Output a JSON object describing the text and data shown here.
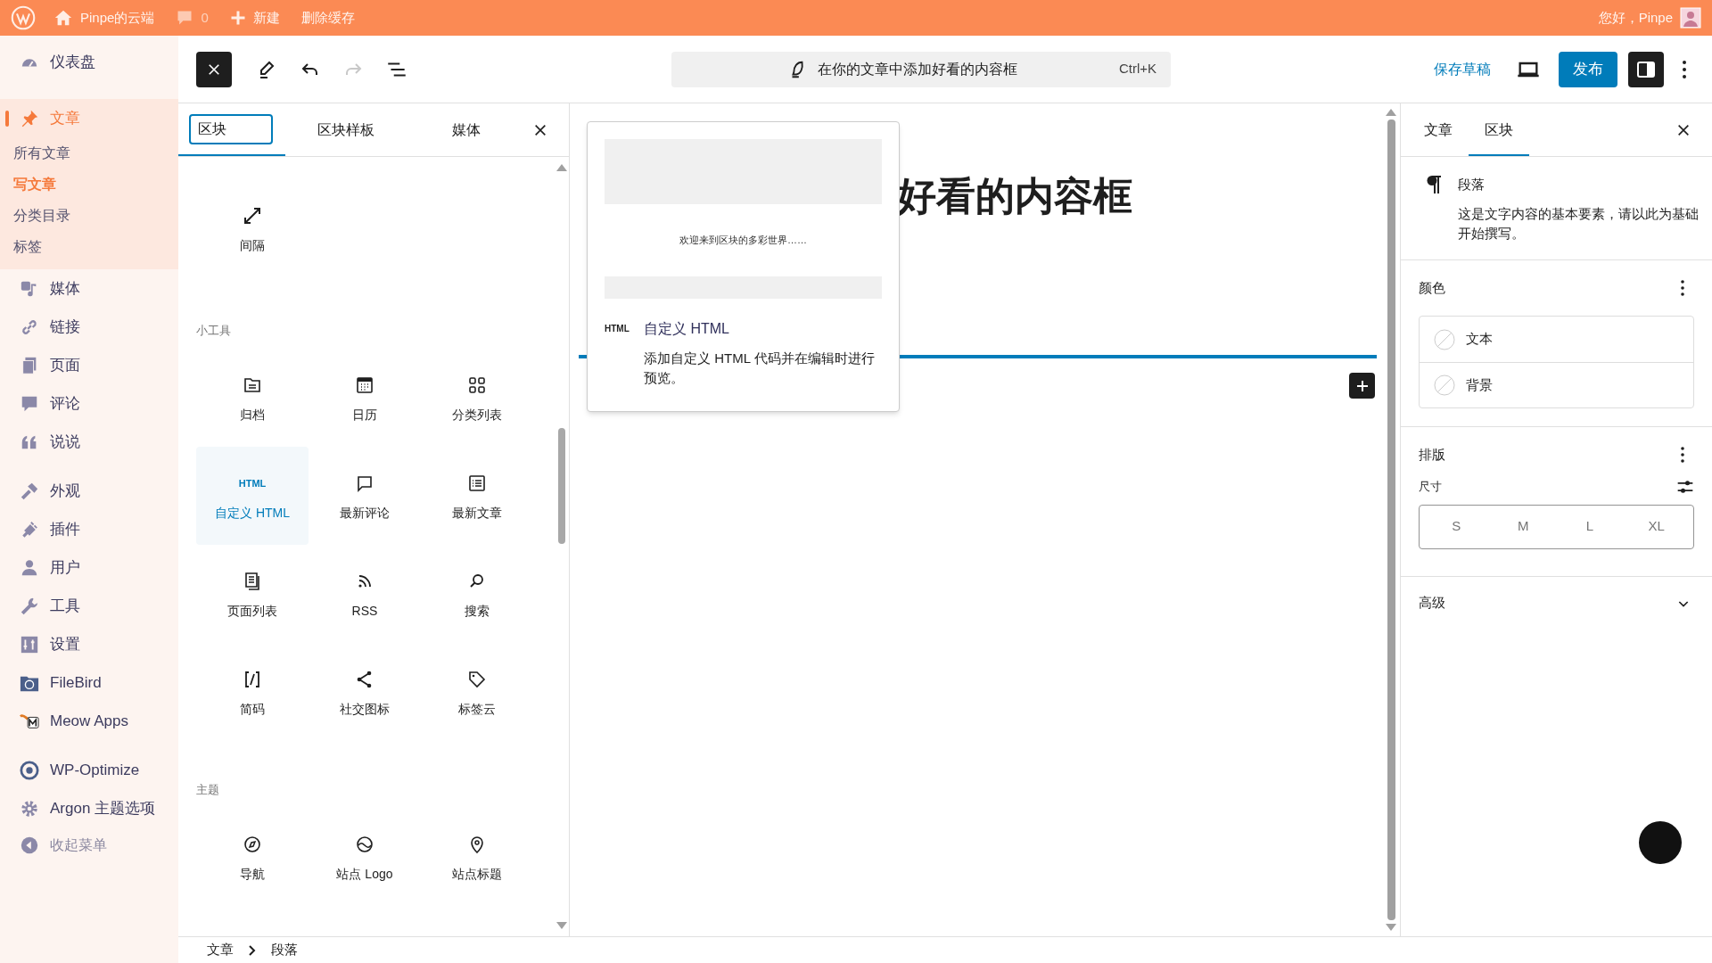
{
  "admin_bar": {
    "site": "Pinpe的云端",
    "comments": "0",
    "new": "新建",
    "clear_cache": "删除缓存",
    "greeting": "您好，Pinpe"
  },
  "sidebar": {
    "groups": [
      [
        {
          "label": "仪表盘",
          "selected": false
        }
      ],
      [
        {
          "label": "文章",
          "selected": true,
          "children": [
            {
              "label": "所有文章",
              "selected": false
            },
            {
              "label": "写文章",
              "selected": true
            },
            {
              "label": "分类目录",
              "selected": false
            },
            {
              "label": "标签",
              "selected": false
            }
          ]
        },
        {
          "label": "媒体",
          "selected": false
        },
        {
          "label": "链接",
          "selected": false
        },
        {
          "label": "页面",
          "selected": false
        },
        {
          "label": "评论",
          "selected": false
        },
        {
          "label": "说说",
          "selected": false
        }
      ],
      [
        {
          "label": "外观",
          "selected": false
        },
        {
          "label": "插件",
          "selected": false
        },
        {
          "label": "用户",
          "selected": false
        },
        {
          "label": "工具",
          "selected": false
        },
        {
          "label": "设置",
          "selected": false
        },
        {
          "label": "FileBird",
          "selected": false
        },
        {
          "label": "Meow Apps",
          "selected": false
        }
      ],
      [
        {
          "label": "WP-Optimize",
          "selected": false
        },
        {
          "label": "Argon 主题选项",
          "selected": false
        }
      ]
    ],
    "collapse": "收起菜单"
  },
  "header": {
    "redo_disabled": true,
    "command": "在你的文章中添加好看的内容框",
    "shortcut": "Ctrl+K",
    "save_draft": "保存草稿",
    "publish": "发布",
    "settings_open": true
  },
  "inserter": {
    "tabs": [
      {
        "label": "区块",
        "selected": true
      },
      {
        "label": "区块样板",
        "selected": false
      },
      {
        "label": "媒体",
        "selected": false
      }
    ],
    "sections": [
      {
        "blocks": [
          {
            "label": "间隔",
            "selected": false
          }
        ]
      },
      {
        "heading": "小工具",
        "blocks": [
          {
            "label": "归档",
            "selected": false
          },
          {
            "label": "日历",
            "selected": false
          },
          {
            "label": "分类列表",
            "selected": false
          },
          {
            "label": "自定义 HTML",
            "icon_text": "HTML",
            "selected": true
          },
          {
            "label": "最新评论",
            "selected": false
          },
          {
            "label": "最新文章",
            "selected": false
          },
          {
            "label": "页面列表",
            "selected": false
          },
          {
            "label": "RSS",
            "selected": false
          },
          {
            "label": "搜索",
            "selected": false
          },
          {
            "label": "简码",
            "selected": false
          },
          {
            "label": "社交图标",
            "selected": false
          },
          {
            "label": "标签云",
            "selected": false
          }
        ]
      },
      {
        "heading": "主题",
        "blocks": [
          {
            "label": "导航",
            "selected": false
          },
          {
            "label": "站点 Logo",
            "selected": false
          },
          {
            "label": "站点标题",
            "selected": false
          }
        ]
      }
    ]
  },
  "canvas": {
    "title_visible": "好看的内容框"
  },
  "preview": {
    "sample": "欢迎来到区块的多彩世界……",
    "icon_text": "HTML",
    "title": "自定义 HTML",
    "description": "添加自定义 HTML 代码并在编辑时进行预览。"
  },
  "settings": {
    "tabs": [
      {
        "label": "文章",
        "selected": false
      },
      {
        "label": "区块",
        "selected": true
      }
    ],
    "block": {
      "title": "段落",
      "description": "这是文字内容的基本要素，请以此为基础开始撰写。"
    },
    "color": {
      "title": "颜色",
      "items": [
        "文本",
        "背景"
      ]
    },
    "typography": {
      "title": "排版",
      "size_label": "尺寸",
      "sizes": [
        {
          "label": "S",
          "selected": false
        },
        {
          "label": "M",
          "selected": false
        },
        {
          "label": "L",
          "selected": false
        },
        {
          "label": "XL",
          "selected": false
        }
      ]
    },
    "advanced": {
      "title": "高级",
      "expanded": false
    }
  },
  "breadcrumb": [
    "文章",
    "段落"
  ]
}
